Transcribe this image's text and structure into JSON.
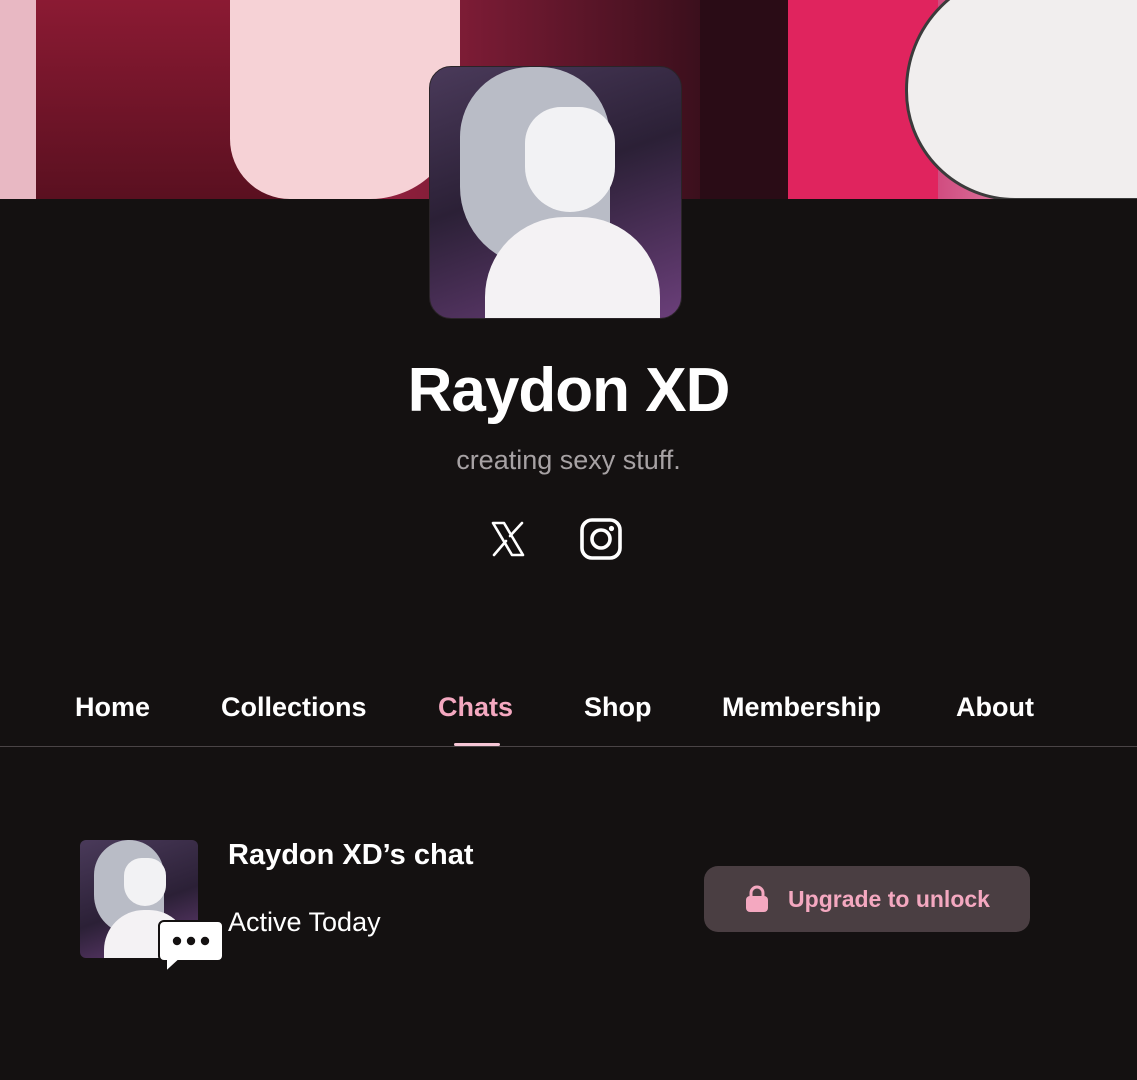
{
  "creator": {
    "name": "Raydon XD",
    "tagline": "creating sexy stuff."
  },
  "social": [
    {
      "icon": "x-logo-icon"
    },
    {
      "icon": "instagram-icon"
    }
  ],
  "tabs": [
    {
      "label": "Home",
      "active": false
    },
    {
      "label": "Collections",
      "active": false
    },
    {
      "label": "Chats",
      "active": true
    },
    {
      "label": "Shop",
      "active": false
    },
    {
      "label": "Membership",
      "active": false
    },
    {
      "label": "About",
      "active": false
    }
  ],
  "chat": {
    "title": "Raydon XD’s chat",
    "status": "Active Today",
    "upgrade_label": "Upgrade to unlock"
  },
  "colors": {
    "background": "#141111",
    "accent_pink": "#f4a8c0",
    "button_bg": "#4a3e42",
    "muted_text": "#a7a2a4"
  }
}
